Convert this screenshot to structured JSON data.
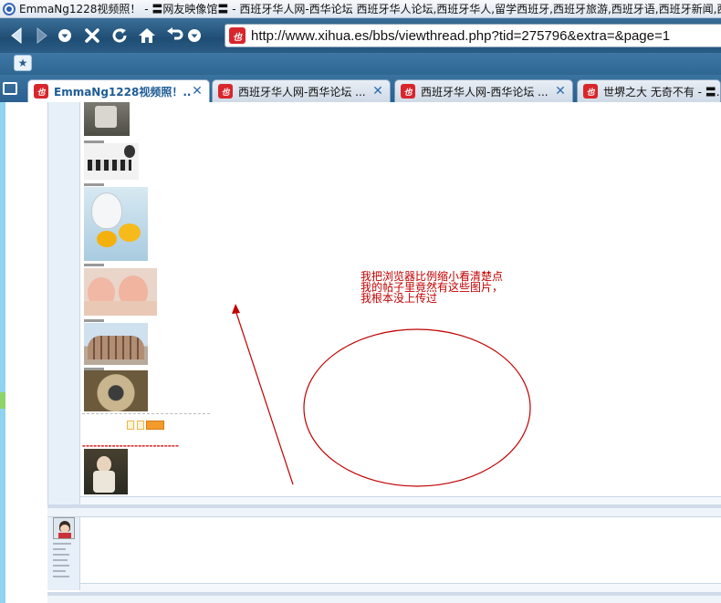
{
  "window": {
    "title": "EmmaNg1228视频照！ - 〓网友映像馆〓 - 西班牙华人网-西华论坛 西班牙华人论坛,西班牙华人,留学西班牙,西班牙旅游,西班牙语,西班牙新闻,西"
  },
  "navbar": {
    "url": "http://www.xihua.es/bbs/viewthread.php?tid=275796&extra=&page=1",
    "site_icon_text": "也",
    "icons": [
      "back-icon",
      "forward-icon",
      "dropdown-icon",
      "stop-icon",
      "refresh-icon",
      "home-icon",
      "undo-icon",
      "dropdown-icon"
    ]
  },
  "bookmarks": {
    "favorites_icon": "star-icon"
  },
  "tabs": [
    {
      "label": "EmmaNg1228视频照！...",
      "active": true
    },
    {
      "label": "西班牙华人网-西华论坛 ...",
      "active": false
    },
    {
      "label": "西班牙华人网-西华论坛 ...",
      "active": false
    },
    {
      "label": "世堺之大 无奇不有 - 〓...",
      "active": false
    }
  ],
  "annotation": {
    "lines": [
      "我把浏览器比例缩小看清楚点",
      "我的帖子里竟然有这些图片，",
      "我根本没上传过"
    ],
    "color": "#c00000"
  },
  "colors": {
    "nav_dark": "#1f4d74",
    "tab_active_text": "#1e5c96",
    "site_red": "#d8262c",
    "annotation_red": "#c00000"
  }
}
